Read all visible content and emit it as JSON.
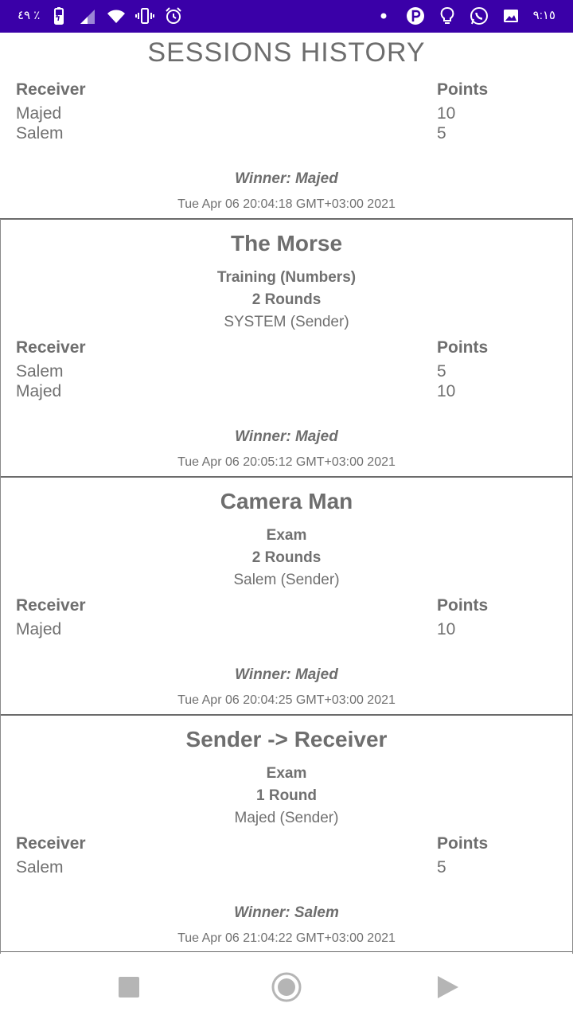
{
  "status_bar": {
    "battery_text": "٤٩ ٪",
    "time": "٩:١٥",
    "icons": [
      "battery-icon",
      "signal-icon",
      "wifi-icon",
      "vibrate-icon",
      "alarm-icon",
      "dot-icon",
      "p-app-icon",
      "bulb-icon",
      "whatsapp-icon",
      "gallery-icon"
    ]
  },
  "page": {
    "title": "SESSIONS HISTORY"
  },
  "sessions": [
    {
      "receiver_header": "Receiver",
      "points_header": "Points",
      "rows": [
        {
          "receiver": "Majed",
          "points": "10"
        },
        {
          "receiver": "Salem",
          "points": "5"
        }
      ],
      "winner": "Winner: Majed",
      "timestamp": "Tue Apr 06 20:04:18 GMT+03:00 2021"
    },
    {
      "title": "The Morse",
      "mode": "Training (Numbers)",
      "rounds": "2 Rounds",
      "sender": "SYSTEM (Sender)",
      "receiver_header": "Receiver",
      "points_header": "Points",
      "rows": [
        {
          "receiver": "Salem",
          "points": "5"
        },
        {
          "receiver": "Majed",
          "points": "10"
        }
      ],
      "winner": "Winner: Majed",
      "timestamp": "Tue Apr 06 20:05:12 GMT+03:00 2021"
    },
    {
      "title": "Camera Man",
      "mode": "Exam",
      "rounds": "2 Rounds",
      "sender": "Salem (Sender)",
      "receiver_header": "Receiver",
      "points_header": "Points",
      "rows": [
        {
          "receiver": "Majed",
          "points": "10"
        }
      ],
      "winner": "Winner: Majed",
      "timestamp": "Tue Apr 06 20:04:25 GMT+03:00 2021"
    },
    {
      "title": "Sender -> Receiver",
      "mode": "Exam",
      "rounds": "1 Round",
      "sender": "Majed (Sender)",
      "receiver_header": "Receiver",
      "points_header": "Points",
      "rows": [
        {
          "receiver": "Salem",
          "points": "5"
        }
      ],
      "winner": "Winner: Salem",
      "timestamp": "Tue Apr 06 21:04:22 GMT+03:00 2021"
    }
  ],
  "nav_bar": {
    "icons": [
      "stop-square-icon",
      "home-circle-icon",
      "play-triangle-icon"
    ]
  }
}
